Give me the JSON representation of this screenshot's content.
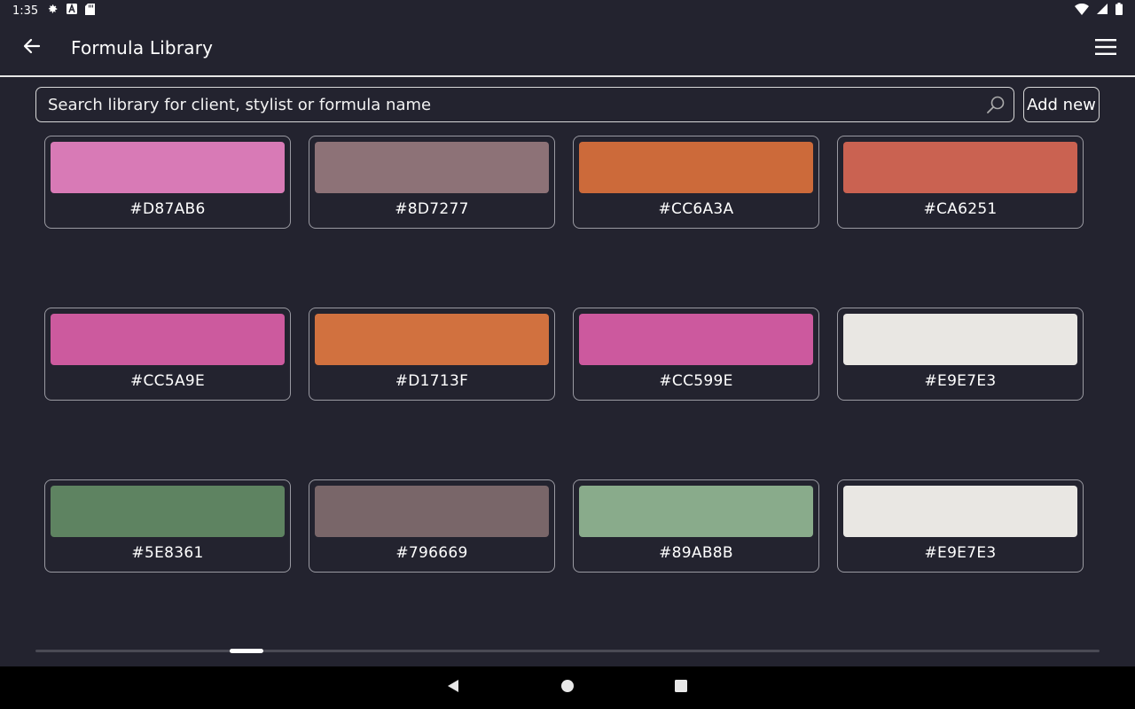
{
  "status_bar": {
    "time": "1:35",
    "icons": [
      "settings-icon",
      "a-notification-icon",
      "sd-card-icon",
      "wifi-icon",
      "signal-icon",
      "battery-icon"
    ]
  },
  "app_bar": {
    "title": "Formula Library",
    "back_icon": "arrow-left-icon",
    "menu_icon": "hamburger-menu-icon"
  },
  "search": {
    "placeholder": "Search library for client, stylist or formula name",
    "value": ""
  },
  "add_button": {
    "label": "Add new"
  },
  "swatches": [
    {
      "code": "#D87AB6",
      "color": "#D87AB6"
    },
    {
      "code": "#8D7277",
      "color": "#8D7277"
    },
    {
      "code": "#CC6A3A",
      "color": "#CC6A3A"
    },
    {
      "code": "#CA6251",
      "color": "#CA6251"
    },
    {
      "code": "#CC5A9E",
      "color": "#CC5A9E"
    },
    {
      "code": "#D1713F",
      "color": "#D1713F"
    },
    {
      "code": "#CC599E",
      "color": "#CC599E"
    },
    {
      "code": "#E9E7E3",
      "color": "#E9E7E3"
    },
    {
      "code": "#5E8361",
      "color": "#5E8361"
    },
    {
      "code": "#796669",
      "color": "#796669"
    },
    {
      "code": "#89AB8B",
      "color": "#89AB8B"
    },
    {
      "code": "#E9E7E3",
      "color": "#E9E7E3"
    }
  ],
  "colors": {
    "background": "#23232f",
    "border": "#9a9aa2",
    "text": "#ffffff"
  }
}
